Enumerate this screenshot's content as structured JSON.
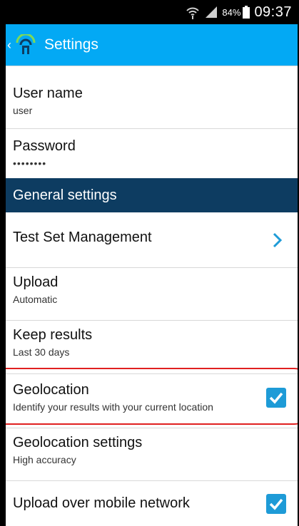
{
  "status_bar": {
    "battery_percent": "84%",
    "time": "09:37",
    "icons": [
      "wifi-icon",
      "signal-icon",
      "battery-icon"
    ]
  },
  "action_bar": {
    "title": "Settings",
    "back_icon": "back-arrow-icon",
    "logo_icon": "app-logo-icon",
    "background_color": "#03a9f4"
  },
  "list": {
    "user_name": {
      "title": "User name",
      "summary": "user"
    },
    "password": {
      "title": "Password",
      "summary": "••••••••"
    },
    "section_header": {
      "label": "General settings",
      "color": "#0d3c61"
    },
    "test_set_management": {
      "title": "Test Set Management"
    },
    "upload": {
      "title": "Upload",
      "summary": "Automatic"
    },
    "keep_results": {
      "title": "Keep results",
      "summary": "Last 30 days"
    },
    "geolocation": {
      "title": "Geolocation",
      "summary": "Identify your results with your current location",
      "checked": true
    },
    "geolocation_settings": {
      "title": "Geolocation settings",
      "summary": "High accuracy"
    },
    "upload_over_mobile_network": {
      "title": "Upload over mobile network",
      "checked": true
    }
  },
  "accent_color": "#1e9bd7",
  "highlight_color": "#e02020"
}
